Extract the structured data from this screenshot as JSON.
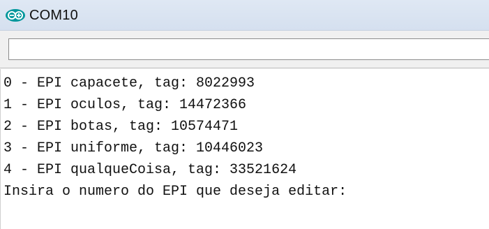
{
  "window": {
    "title": "COM10",
    "icon": "arduino-serial-monitor-icon"
  },
  "input": {
    "value": "",
    "placeholder": ""
  },
  "serial_output": {
    "lines": [
      "0 - EPI capacete, tag: 8022993",
      "1 - EPI oculos, tag: 14472366",
      "2 - EPI botas, tag: 10574471",
      "3 - EPI uniforme, tag: 10446023",
      "4 - EPI qualqueCoisa, tag: 33521624",
      "Insira o numero do EPI que deseja editar:"
    ]
  },
  "colors": {
    "titlebar": "#d9e4f2",
    "arduino_teal": "#00979c",
    "text": "#111111",
    "input_strip": "#f0f0f0"
  }
}
